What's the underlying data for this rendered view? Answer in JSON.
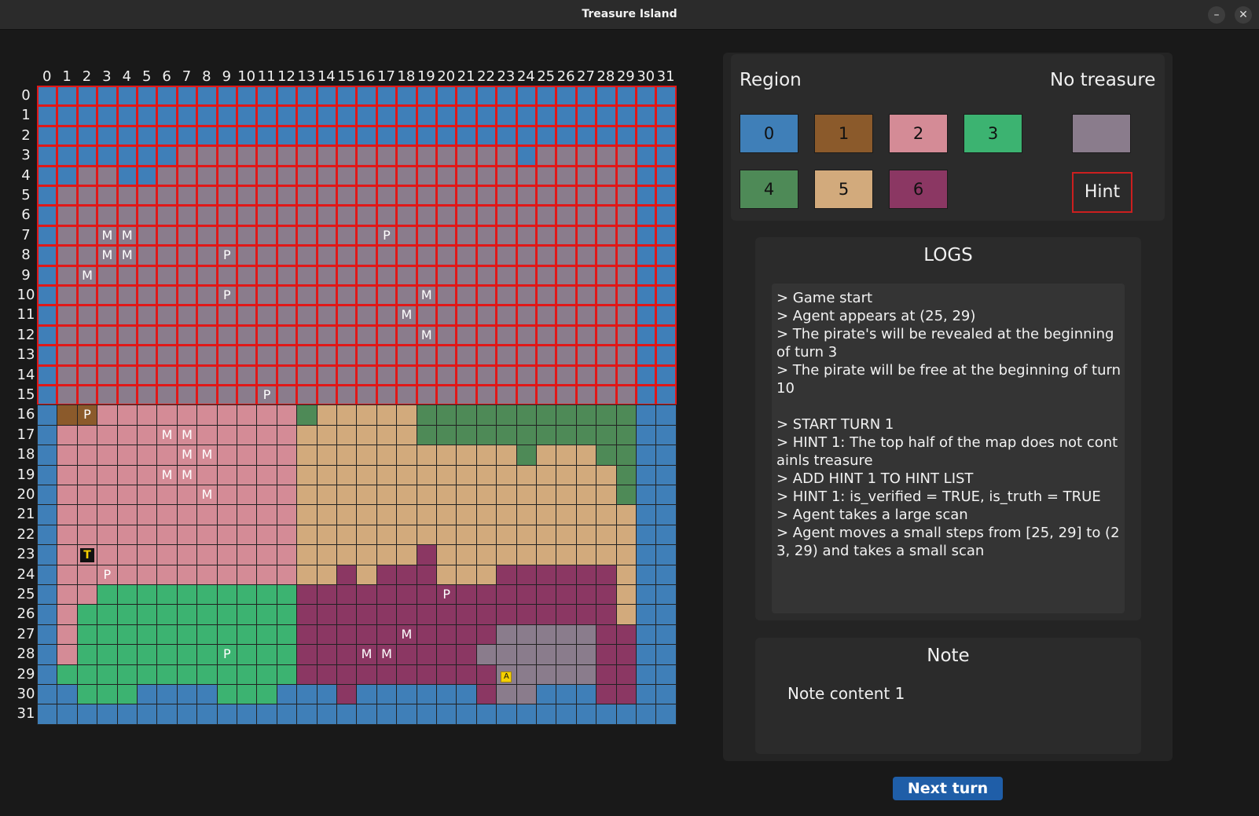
{
  "window": {
    "title": "Treasure Island",
    "minimize_icon": "minus-icon",
    "close_icon": "close-icon"
  },
  "map": {
    "size": 32,
    "col_labels": [
      "0",
      "1",
      "2",
      "3",
      "4",
      "5",
      "6",
      "7",
      "8",
      "9",
      "10",
      "11",
      "12",
      "13",
      "14",
      "15",
      "16",
      "17",
      "18",
      "19",
      "20",
      "21",
      "22",
      "23",
      "24",
      "25",
      "26",
      "27",
      "28",
      "29",
      "30",
      "31"
    ],
    "row_labels": [
      "0",
      "1",
      "2",
      "3",
      "4",
      "5",
      "6",
      "7",
      "8",
      "9",
      "10",
      "11",
      "12",
      "13",
      "14",
      "15",
      "16",
      "17",
      "18",
      "19",
      "20",
      "21",
      "22",
      "23",
      "24",
      "25",
      "26",
      "27",
      "28",
      "29",
      "30",
      "31"
    ],
    "region_colors": {
      "0": "#3f7fb8",
      "1": "#8b5a2b",
      "2": "#d48b96",
      "3": "#3cb371",
      "4": "#4e8a57",
      "5": "#d2aa7c",
      "6": "#8b3763",
      "N": "#8a7c8c"
    },
    "hint_border_color": "#e01818",
    "tiles": [
      "00000000000000000000000000000000",
      "00000000000000000000000000000000",
      "000000000000000000000000000000000",
      "0000000NNNNNNNNNNNNNNNNN0NNNNN00",
      "00NN00NNNNNNNNNNNNNNNNNNNNNNNN00",
      "0NNNNNNNNNNNNNNNNNNNNNNNNNNNNN00",
      "0NNNNNNNNNNNNNNNNNNNNNNNNNNNNN00",
      "0NNNNNNNNNNNNNNNNNNNNNNNNNNNNN00",
      "0NNNNNNNNNNNNNNNNNNNNNNNNNNNNN00",
      "0NNNNNNNNNNNNNNNNNNNNNNNNNNNNN00",
      "0NNNNNNNNNNNNNNNNNNNNNNNNNNNNN00",
      "0NNNNNNNNNNNNNNNNNNNNNNNNNNNNN00",
      "0NNNNNNNNNNNNNNNNNNNNNNNNNNNNN00",
      "0NNNNNNNNNNNNNNNNNNNNNNNNNNNNN00",
      "0NNNNNNNNNNNNNNNNNNNNNNNNNNNNN00",
      "0NNNNNNNNNNNNNNNNNNNNNNNNNNNNN00",
      "01122222222224555554444444444400",
      "02222222222225555554444444444400",
      "02222222222225555555555545554400",
      "02222222222225555555555555555400",
      "02222222222225555555555555555400",
      "02222222222225555555555555555500",
      "02222222222225555555555555555500",
      "02222222222225555556555555555500",
      "02222222222225565666555666666500",
      "02233333333336666666666666666500",
      "0233333333333666666666666666650",
      "02333333333336666666666NNNNN6600",
      "0233333333333666666666NNNNNN6600",
      "03333333333336666666666NNNNN6600",
      "00333000033300060000006NN0006600",
      "00000000000000000000000000000000"
    ],
    "hint_rows": [
      0,
      1,
      2,
      3,
      4,
      5,
      6,
      7,
      8,
      9,
      10,
      11,
      12,
      13,
      14,
      15
    ],
    "markers": [
      {
        "row": 7,
        "col": 3,
        "text": "M"
      },
      {
        "row": 7,
        "col": 4,
        "text": "M"
      },
      {
        "row": 7,
        "col": 17,
        "text": "P"
      },
      {
        "row": 8,
        "col": 3,
        "text": "M"
      },
      {
        "row": 8,
        "col": 4,
        "text": "M"
      },
      {
        "row": 8,
        "col": 9,
        "text": "P"
      },
      {
        "row": 9,
        "col": 2,
        "text": "M"
      },
      {
        "row": 10,
        "col": 9,
        "text": "P"
      },
      {
        "row": 10,
        "col": 19,
        "text": "M"
      },
      {
        "row": 11,
        "col": 18,
        "text": "M"
      },
      {
        "row": 12,
        "col": 19,
        "text": "M"
      },
      {
        "row": 15,
        "col": 11,
        "text": "P"
      },
      {
        "row": 16,
        "col": 2,
        "text": "P"
      },
      {
        "row": 17,
        "col": 6,
        "text": "M"
      },
      {
        "row": 17,
        "col": 7,
        "text": "M"
      },
      {
        "row": 18,
        "col": 7,
        "text": "M"
      },
      {
        "row": 18,
        "col": 8,
        "text": "M"
      },
      {
        "row": 19,
        "col": 6,
        "text": "M"
      },
      {
        "row": 19,
        "col": 7,
        "text": "M"
      },
      {
        "row": 20,
        "col": 8,
        "text": "M"
      },
      {
        "row": 23,
        "col": 2,
        "text": "T"
      },
      {
        "row": 24,
        "col": 3,
        "text": "P"
      },
      {
        "row": 25,
        "col": 20,
        "text": "P"
      },
      {
        "row": 27,
        "col": 18,
        "text": "M"
      },
      {
        "row": 28,
        "col": 9,
        "text": "P"
      },
      {
        "row": 28,
        "col": 16,
        "text": "M"
      },
      {
        "row": 28,
        "col": 17,
        "text": "M"
      },
      {
        "row": 29,
        "col": 23,
        "text": "A"
      }
    ]
  },
  "legend": {
    "title": "Region",
    "no_treasure_label": "No treasure",
    "regions": [
      {
        "label": "0",
        "color": "#3f7fb8"
      },
      {
        "label": "1",
        "color": "#8b5a2b"
      },
      {
        "label": "2",
        "color": "#d48b96"
      },
      {
        "label": "3",
        "color": "#3cb371"
      },
      {
        "label": "4",
        "color": "#4e8a57"
      },
      {
        "label": "5",
        "color": "#d2aa7c"
      },
      {
        "label": "6",
        "color": "#8b3763"
      }
    ],
    "no_treasure_color": "#8a7c8c",
    "hint_label": "Hint",
    "hint_color": "#cc1f1f"
  },
  "logs": {
    "title": "LOGS",
    "lines": [
      "> Game start",
      "> Agent appears at (25, 29)",
      "> The pirate's will be revealed at the beginning of turn 3",
      "> The pirate will be free at the beginning of turn 10",
      "",
      "> START TURN 1",
      "> HINT 1: The top half of the map does not containls treasure",
      "> ADD HINT 1 TO HINT LIST",
      "> HINT 1: is_verified = TRUE, is_truth = TRUE",
      "> Agent takes a large scan",
      "> Agent moves a small steps from [25, 29] to (23, 29) and takes a small scan"
    ]
  },
  "note": {
    "title": "Note",
    "content": "Note content 1"
  },
  "controls": {
    "next_turn_label": "Next turn",
    "next_turn_color": "#1f5ea8"
  }
}
